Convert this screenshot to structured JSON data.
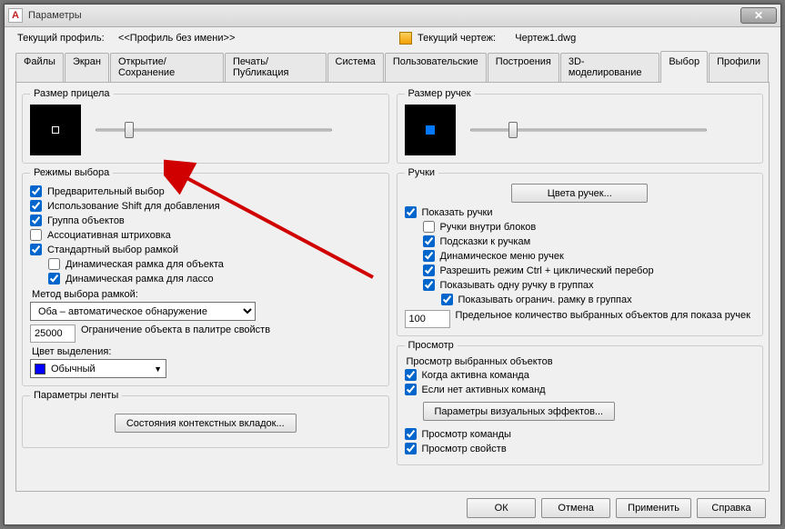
{
  "window": {
    "title": "Параметры"
  },
  "profile": {
    "current_label": "Текущий профиль:",
    "current_value": "<<Профиль без имени>>",
    "drawing_label": "Текущий чертеж:",
    "drawing_value": "Чертеж1.dwg"
  },
  "tabs": [
    "Файлы",
    "Экран",
    "Открытие/Сохранение",
    "Печать/Публикация",
    "Система",
    "Пользовательские",
    "Построения",
    "3D-моделирование",
    "Выбор",
    "Профили"
  ],
  "active_tab_index": 8,
  "left": {
    "aim_legend": "Размер прицела",
    "modes_legend": "Режимы выбора",
    "preselect": "Предварительный выбор",
    "shift_add": "Использование Shift для добавления",
    "group_objects": "Группа объектов",
    "assoc_hatch": "Ассоциативная штриховка",
    "std_frame": "Стандартный выбор рамкой",
    "dyn_frame_obj": "Динамическая рамка для объекта",
    "dyn_frame_lasso": "Динамическая рамка для лассо",
    "method_label": "Метод выбора рамкой:",
    "method_value": "Оба – автоматическое обнаружение",
    "limit_value": "25000",
    "limit_label": "Ограничение объекта в палитре свойств",
    "sel_color_label": "Цвет выделения:",
    "sel_color_value": "Обычный",
    "ribbon_legend": "Параметры ленты",
    "ribbon_btn": "Состояния контекстных вкладок..."
  },
  "right": {
    "grips_size_legend": "Размер ручек",
    "grips_legend": "Ручки",
    "grip_colors_btn": "Цвета ручек...",
    "show_grips": "Показать ручки",
    "grips_in_blocks": "Ручки внутри блоков",
    "grip_tips": "Подсказки к ручкам",
    "dyn_grip_menu": "Динамическое меню ручек",
    "ctrl_cycling": "Разрешить режим Ctrl + циклический перебор",
    "one_grip_groups": "Показывать одну ручку в группах",
    "bounding_groups": "Показывать огранич. рамку в группах",
    "grip_limit_value": "100",
    "grip_limit_label": "Предельное количество выбранных объектов для показа ручек",
    "preview_legend": "Просмотр",
    "preview_sub": "Просмотр выбранных объектов",
    "when_cmd_active": "Когда активна команда",
    "when_no_cmd": "Если нет активных команд",
    "visual_effects_btn": "Параметры визуальных эффектов...",
    "preview_cmd": "Просмотр команды",
    "preview_props": "Просмотр свойств"
  },
  "footer": {
    "ok": "ОК",
    "cancel": "Отмена",
    "apply": "Применить",
    "help": "Справка"
  }
}
